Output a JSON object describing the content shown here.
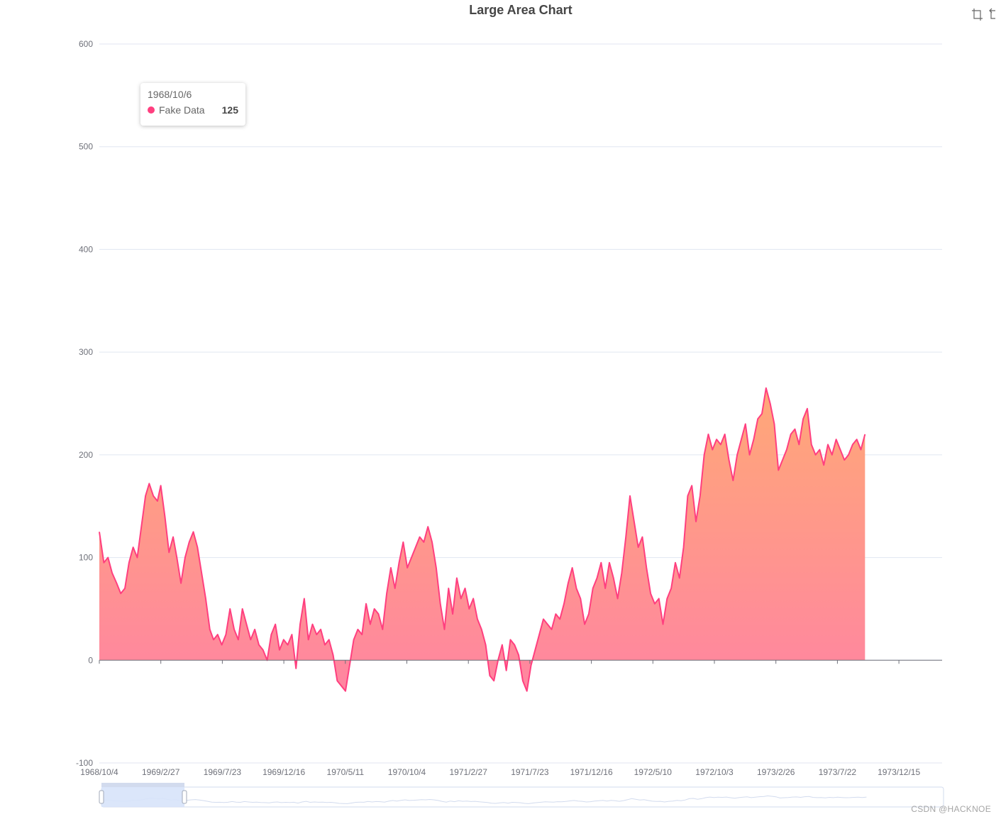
{
  "chart_data": {
    "type": "area",
    "title": "Large Area Chart",
    "ylim": [
      -100,
      600
    ],
    "yticks": [
      -100,
      0,
      100,
      200,
      300,
      400,
      500,
      600
    ],
    "xtick_labels": [
      "1968/10/4",
      "1969/2/27",
      "1969/7/23",
      "1969/12/16",
      "1970/5/11",
      "1970/10/4",
      "1971/2/27",
      "1971/7/23",
      "1971/12/16",
      "1972/5/10",
      "1972/10/3",
      "1973/2/26",
      "1973/7/22",
      "1973/12/15"
    ],
    "x_start": "1968/10/4",
    "x_end": "1974/5/10",
    "series": [
      {
        "name": "Fake Data",
        "points": [
          [
            "1968/10/4",
            125
          ],
          [
            "1968/10/15",
            95
          ],
          [
            "1968/10/25",
            100
          ],
          [
            "1968/11/4",
            85
          ],
          [
            "1968/11/15",
            75
          ],
          [
            "1968/11/25",
            65
          ],
          [
            "1968/12/5",
            70
          ],
          [
            "1968/12/15",
            95
          ],
          [
            "1968/12/25",
            110
          ],
          [
            "1969/1/4",
            100
          ],
          [
            "1969/1/14",
            130
          ],
          [
            "1969/1/24",
            160
          ],
          [
            "1969/2/2",
            172
          ],
          [
            "1969/2/12",
            160
          ],
          [
            "1969/2/22",
            155
          ],
          [
            "1969/3/2",
            170
          ],
          [
            "1969/3/12",
            140
          ],
          [
            "1969/3/22",
            105
          ],
          [
            "1969/4/1",
            120
          ],
          [
            "1969/4/10",
            100
          ],
          [
            "1969/4/20",
            75
          ],
          [
            "1969/4/30",
            100
          ],
          [
            "1969/5/10",
            115
          ],
          [
            "1969/5/20",
            125
          ],
          [
            "1969/5/30",
            110
          ],
          [
            "1969/6/9",
            85
          ],
          [
            "1969/6/19",
            60
          ],
          [
            "1969/6/29",
            30
          ],
          [
            "1969/7/8",
            20
          ],
          [
            "1969/7/18",
            25
          ],
          [
            "1969/7/28",
            15
          ],
          [
            "1969/8/7",
            25
          ],
          [
            "1969/8/17",
            50
          ],
          [
            "1969/8/27",
            30
          ],
          [
            "1969/9/6",
            20
          ],
          [
            "1969/9/16",
            50
          ],
          [
            "1969/9/26",
            35
          ],
          [
            "1969/10/6",
            20
          ],
          [
            "1969/10/16",
            30
          ],
          [
            "1969/10/26",
            15
          ],
          [
            "1969/11/5",
            10
          ],
          [
            "1969/11/15",
            0
          ],
          [
            "1969/11/25",
            25
          ],
          [
            "1969/12/5",
            35
          ],
          [
            "1969/12/15",
            10
          ],
          [
            "1969/12/25",
            20
          ],
          [
            "1970/1/4",
            15
          ],
          [
            "1970/1/14",
            25
          ],
          [
            "1970/1/24",
            -8
          ],
          [
            "1970/2/3",
            35
          ],
          [
            "1970/2/13",
            60
          ],
          [
            "1970/2/23",
            20
          ],
          [
            "1970/3/5",
            35
          ],
          [
            "1970/3/15",
            25
          ],
          [
            "1970/3/25",
            30
          ],
          [
            "1970/4/4",
            15
          ],
          [
            "1970/4/14",
            20
          ],
          [
            "1970/4/24",
            5
          ],
          [
            "1970/5/4",
            -20
          ],
          [
            "1970/5/14",
            -25
          ],
          [
            "1970/5/24",
            -30
          ],
          [
            "1970/6/3",
            -5
          ],
          [
            "1970/6/13",
            20
          ],
          [
            "1970/6/23",
            30
          ],
          [
            "1970/7/3",
            25
          ],
          [
            "1970/7/13",
            55
          ],
          [
            "1970/7/23",
            35
          ],
          [
            "1970/8/2",
            50
          ],
          [
            "1970/8/12",
            45
          ],
          [
            "1970/8/22",
            30
          ],
          [
            "1970/9/1",
            65
          ],
          [
            "1970/9/11",
            90
          ],
          [
            "1970/9/21",
            70
          ],
          [
            "1970/10/1",
            95
          ],
          [
            "1970/10/11",
            115
          ],
          [
            "1970/10/21",
            90
          ],
          [
            "1970/10/31",
            100
          ],
          [
            "1970/11/10",
            110
          ],
          [
            "1970/11/20",
            120
          ],
          [
            "1970/11/30",
            115
          ],
          [
            "1970/12/10",
            130
          ],
          [
            "1970/12/20",
            115
          ],
          [
            "1970/12/30",
            90
          ],
          [
            "1971/1/9",
            55
          ],
          [
            "1971/1/19",
            30
          ],
          [
            "1971/1/29",
            70
          ],
          [
            "1971/2/8",
            45
          ],
          [
            "1971/2/18",
            80
          ],
          [
            "1971/2/28",
            60
          ],
          [
            "1971/3/10",
            70
          ],
          [
            "1971/3/20",
            50
          ],
          [
            "1971/3/30",
            60
          ],
          [
            "1971/4/9",
            40
          ],
          [
            "1971/4/19",
            30
          ],
          [
            "1971/4/29",
            15
          ],
          [
            "1971/5/9",
            -15
          ],
          [
            "1971/5/19",
            -20
          ],
          [
            "1971/5/29",
            0
          ],
          [
            "1971/6/8",
            15
          ],
          [
            "1971/6/18",
            -10
          ],
          [
            "1971/6/28",
            20
          ],
          [
            "1971/7/8",
            15
          ],
          [
            "1971/7/18",
            5
          ],
          [
            "1971/7/28",
            -20
          ],
          [
            "1971/8/7",
            -30
          ],
          [
            "1971/8/17",
            -5
          ],
          [
            "1971/8/27",
            10
          ],
          [
            "1971/9/6",
            25
          ],
          [
            "1971/9/16",
            40
          ],
          [
            "1971/9/26",
            35
          ],
          [
            "1971/10/6",
            30
          ],
          [
            "1971/10/16",
            45
          ],
          [
            "1971/10/26",
            40
          ],
          [
            "1971/11/5",
            55
          ],
          [
            "1971/11/15",
            75
          ],
          [
            "1971/11/25",
            90
          ],
          [
            "1971/12/5",
            70
          ],
          [
            "1971/12/15",
            60
          ],
          [
            "1971/12/25",
            35
          ],
          [
            "1972/1/4",
            45
          ],
          [
            "1972/1/14",
            70
          ],
          [
            "1972/1/24",
            80
          ],
          [
            "1972/2/3",
            95
          ],
          [
            "1972/2/13",
            70
          ],
          [
            "1972/2/23",
            95
          ],
          [
            "1972/3/4",
            80
          ],
          [
            "1972/3/14",
            60
          ],
          [
            "1972/3/24",
            85
          ],
          [
            "1972/4/3",
            120
          ],
          [
            "1972/4/13",
            160
          ],
          [
            "1972/4/23",
            135
          ],
          [
            "1972/5/3",
            110
          ],
          [
            "1972/5/13",
            120
          ],
          [
            "1972/5/23",
            90
          ],
          [
            "1972/6/2",
            65
          ],
          [
            "1972/6/12",
            55
          ],
          [
            "1972/6/22",
            60
          ],
          [
            "1972/7/2",
            35
          ],
          [
            "1972/7/12",
            60
          ],
          [
            "1972/7/22",
            70
          ],
          [
            "1972/8/1",
            95
          ],
          [
            "1972/8/11",
            80
          ],
          [
            "1972/8/21",
            110
          ],
          [
            "1972/8/31",
            160
          ],
          [
            "1972/9/10",
            170
          ],
          [
            "1972/9/20",
            135
          ],
          [
            "1972/9/30",
            160
          ],
          [
            "1972/10/10",
            200
          ],
          [
            "1972/10/20",
            220
          ],
          [
            "1972/10/30",
            205
          ],
          [
            "1972/11/9",
            215
          ],
          [
            "1972/11/19",
            210
          ],
          [
            "1972/11/29",
            220
          ],
          [
            "1972/12/9",
            195
          ],
          [
            "1972/12/19",
            175
          ],
          [
            "1972/12/29",
            200
          ],
          [
            "1973/1/8",
            215
          ],
          [
            "1973/1/18",
            230
          ],
          [
            "1973/1/28",
            200
          ],
          [
            "1973/2/7",
            215
          ],
          [
            "1973/2/17",
            235
          ],
          [
            "1973/2/27",
            240
          ],
          [
            "1973/3/9",
            265
          ],
          [
            "1973/3/19",
            250
          ],
          [
            "1973/3/29",
            230
          ],
          [
            "1973/4/8",
            185
          ],
          [
            "1973/4/18",
            195
          ],
          [
            "1973/4/28",
            205
          ],
          [
            "1973/5/8",
            220
          ],
          [
            "1973/5/18",
            225
          ],
          [
            "1973/5/28",
            210
          ],
          [
            "1973/6/7",
            235
          ],
          [
            "1973/6/17",
            245
          ],
          [
            "1973/6/27",
            210
          ],
          [
            "1973/7/7",
            200
          ],
          [
            "1973/7/17",
            205
          ],
          [
            "1973/7/27",
            190
          ],
          [
            "1973/8/6",
            210
          ],
          [
            "1973/8/16",
            200
          ],
          [
            "1973/8/26",
            215
          ],
          [
            "1973/9/5",
            205
          ],
          [
            "1973/9/15",
            195
          ],
          [
            "1973/9/25",
            200
          ],
          [
            "1973/10/5",
            210
          ],
          [
            "1973/10/15",
            215
          ],
          [
            "1973/10/25",
            205
          ],
          [
            "1973/11/4",
            220
          ]
        ]
      }
    ],
    "colors": {
      "line": "#ff3f7f",
      "area_top": "#ffa877",
      "area_bottom": "#ff85a1",
      "grid": "#e0e6f1",
      "axis_label": "#6e7079",
      "axis_line": "#6e7079"
    }
  },
  "tooltip": {
    "date": "1968/10/6",
    "series_name": "Fake Data",
    "value": "125"
  },
  "toolbox": {
    "icons": [
      "zoom-select-icon",
      "zoom-reset-icon"
    ]
  },
  "watermark": "CSDN @HACKNOE"
}
